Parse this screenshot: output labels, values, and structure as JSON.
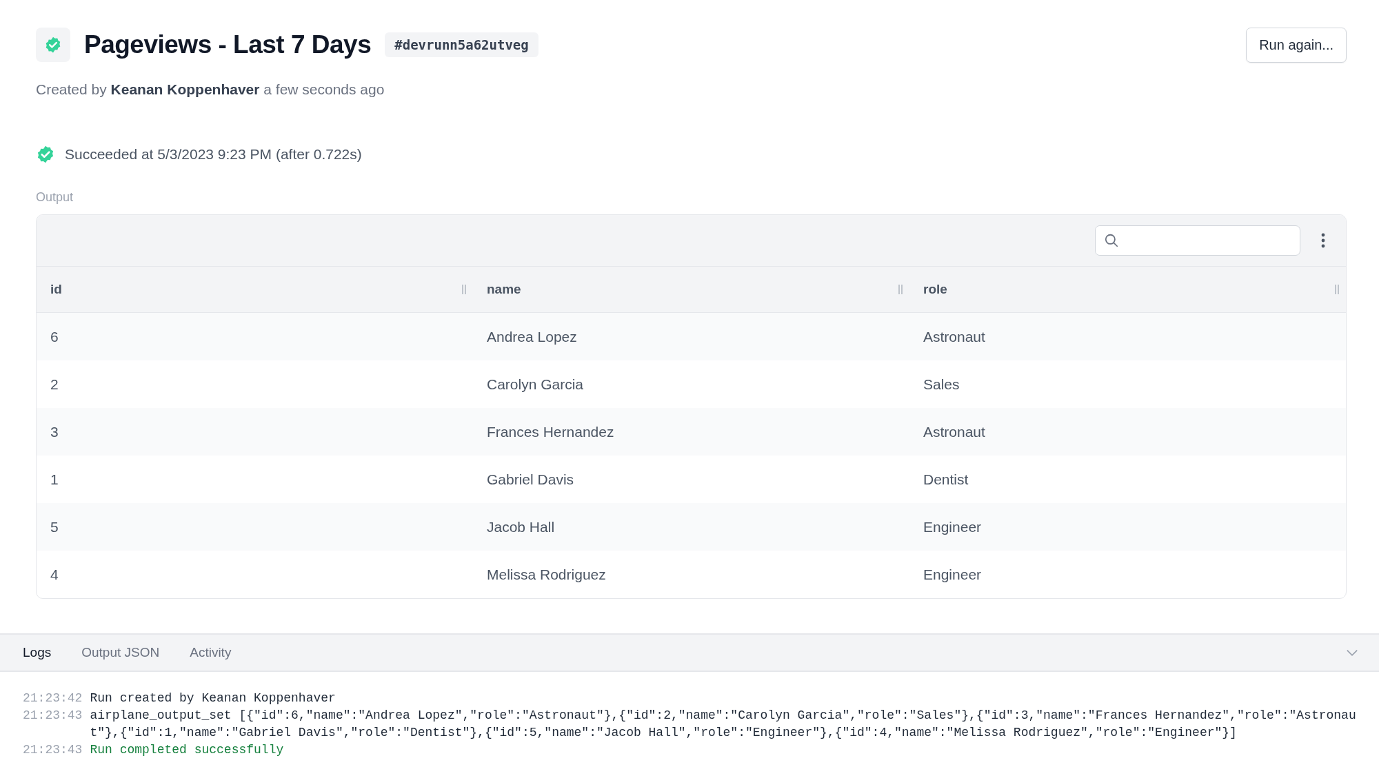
{
  "header": {
    "title": "Pageviews - Last 7 Days",
    "run_id": "#devrunn5a62utveg",
    "succeeded": true,
    "created": "Created by **Keanan Koppenhaver** a few seconds ago",
    "button": "Run again..."
  },
  "result": {
    "succeeded": true,
    "text": "Succeeded at 5/3/2023 9:23 PM (after 0.722s)"
  },
  "output": {
    "label": "Output",
    "columns": [
      "id",
      "name",
      "role"
    ],
    "rows": [
      [
        "6",
        "Andrea Lopez",
        "Astronaut"
      ],
      [
        "2",
        "Carolyn Garcia",
        "Sales"
      ],
      [
        "3",
        "Frances Hernandez",
        "Astronaut"
      ],
      [
        "1",
        "Gabriel Davis",
        "Dentist"
      ],
      [
        "5",
        "Jacob Hall",
        "Engineer"
      ],
      [
        "4",
        "Melissa Rodriguez",
        "Engineer"
      ]
    ]
  },
  "tabs": [
    {
      "label": "Logs",
      "selected": true
    },
    {
      "label": "Output JSON",
      "selected": false
    },
    {
      "label": "Activity",
      "selected": false
    }
  ],
  "logs": [
    {
      "time": "21:23:42",
      "kind": "info",
      "message": "Run created by Keanan Koppenhaver"
    },
    {
      "time": "21:23:43",
      "kind": "info",
      "message": "airplane_output_set [{\"id\":6,\"name\":\"Andrea Lopez\",\"role\":\"Astronaut\"},{\"id\":2,\"name\":\"Carolyn Garcia\",\"role\":\"Sales\"},{\"id\":3,\"name\":\"Frances Hernandez\",\"role\":\"Astronaut\"},{\"id\":1,\"name\":\"Gabriel Davis\",\"role\":\"Dentist\"},{\"id\":5,\"name\":\"Jacob Hall\",\"role\":\"Engineer\"},{\"id\":4,\"name\":\"Melissa Rodriguez\",\"role\":\"Engineer\"}]"
    },
    {
      "time": "21:23:43",
      "kind": "success",
      "message": "Run completed successfully"
    }
  ]
}
